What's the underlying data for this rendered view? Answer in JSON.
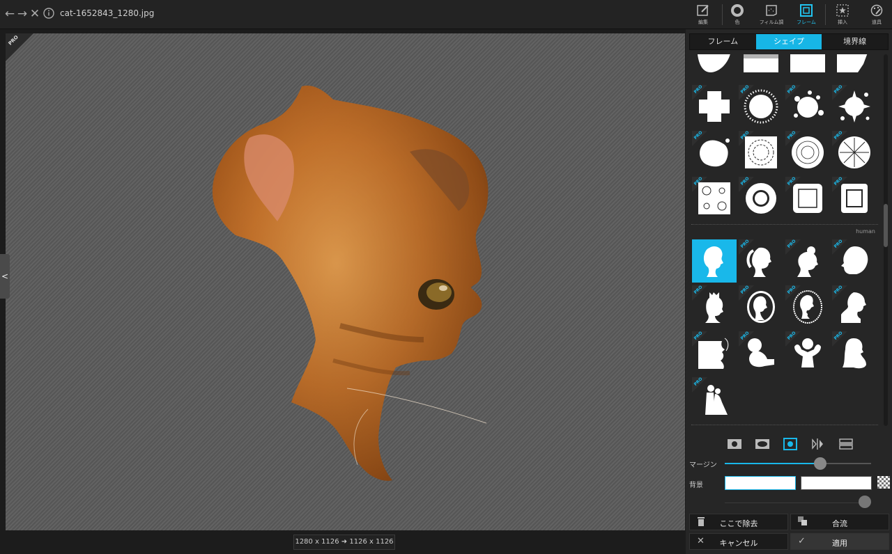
{
  "topbar": {
    "back_icon": "arrow-left-icon",
    "forward_icon": "arrow-right-icon",
    "close_icon": "close-icon",
    "info_icon": "info-icon",
    "filename": "cat-1652843_1280.jpg",
    "tools": [
      {
        "label": "編集",
        "icon": "edit-icon"
      },
      {
        "label": "色",
        "icon": "color-icon"
      },
      {
        "label": "フィルム調",
        "icon": "film-icon"
      },
      {
        "label": "フレーム",
        "icon": "frame-icon",
        "active": true
      },
      {
        "label": "挿入",
        "icon": "insert-icon"
      },
      {
        "label": "道具",
        "icon": "tools-icon"
      }
    ]
  },
  "canvas": {
    "pro_badge": "PRO",
    "size_info": "1280 x 1126 ➜ 1126 x 1126"
  },
  "panel": {
    "tabs": [
      {
        "label": "フレーム"
      },
      {
        "label": "シェイプ",
        "active": true
      },
      {
        "label": "境界線"
      }
    ],
    "pro_label": "PRO",
    "category_human": "human",
    "margin_label": "マージン",
    "margin_value": 0.65,
    "background_label": "背景",
    "bg_color_1": "#ffffff",
    "bg_color_2": "#ffffff",
    "remove_label": "ここで除去",
    "merge_label": "合流",
    "cancel_label": "キャンセル",
    "apply_label": "適用"
  },
  "colors": {
    "accent": "#19b8ea",
    "canvas_bg": "#5a5a5a",
    "panel_bg": "#262626"
  }
}
